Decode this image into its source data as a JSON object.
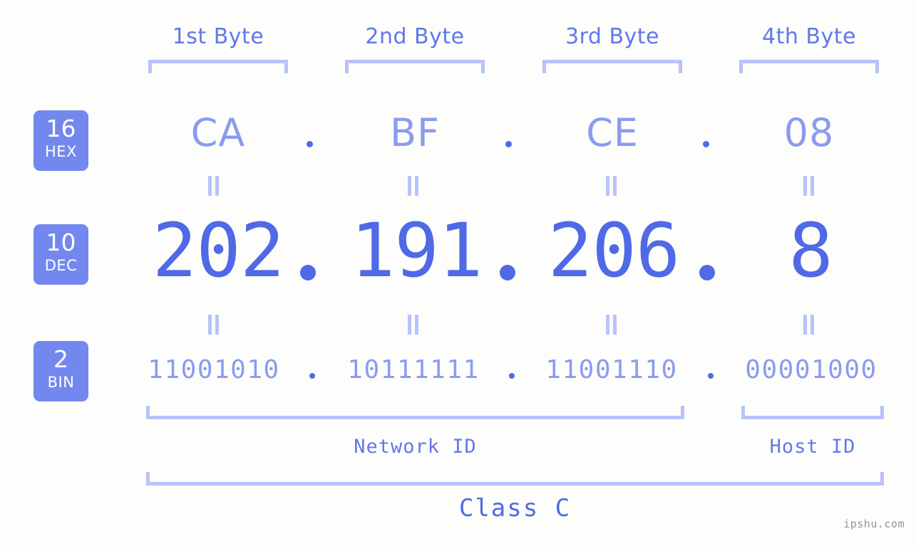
{
  "watermark": "ipshu.com",
  "colors": {
    "background": "#fdfefb",
    "accent_strong": "#5069e6",
    "accent_mid": "#5f78ec",
    "accent_light": "#8b9bf0",
    "bracket": "#b8c2fb",
    "badge_fill": "#7388ee",
    "badge_text": "#ffffff",
    "watermark_text": "#949494"
  },
  "byte_headers": [
    {
      "label": "1st Byte"
    },
    {
      "label": "2nd Byte"
    },
    {
      "label": "3rd Byte"
    },
    {
      "label": "4th Byte"
    }
  ],
  "radix_badges": [
    {
      "number": "16",
      "unit": "HEX"
    },
    {
      "number": "10",
      "unit": "DEC"
    },
    {
      "number": "2",
      "unit": "BIN"
    }
  ],
  "rows": {
    "hex": {
      "radix": "16",
      "unit": "HEX",
      "values": [
        "CA",
        "BF",
        "CE",
        "08"
      ],
      "separator": "."
    },
    "dec": {
      "radix": "10",
      "unit": "DEC",
      "values": [
        "202",
        "191",
        "206",
        "8"
      ],
      "separator": ".",
      "full": "202.191.206.8"
    },
    "bin": {
      "radix": "2",
      "unit": "BIN",
      "values": [
        "11001010",
        "10111111",
        "11001110",
        "00001000"
      ],
      "separator": ".",
      "full": "11001010.10111111.11001110.00001000"
    }
  },
  "equality_marks": {
    "glyph": "||",
    "count_per_row": 4,
    "rows": 2
  },
  "segments": {
    "network_id": {
      "label": "Network ID",
      "bytes": "1-3"
    },
    "host_id": {
      "label": "Host ID",
      "bytes": "4"
    }
  },
  "address_class": {
    "label": "Class C"
  }
}
